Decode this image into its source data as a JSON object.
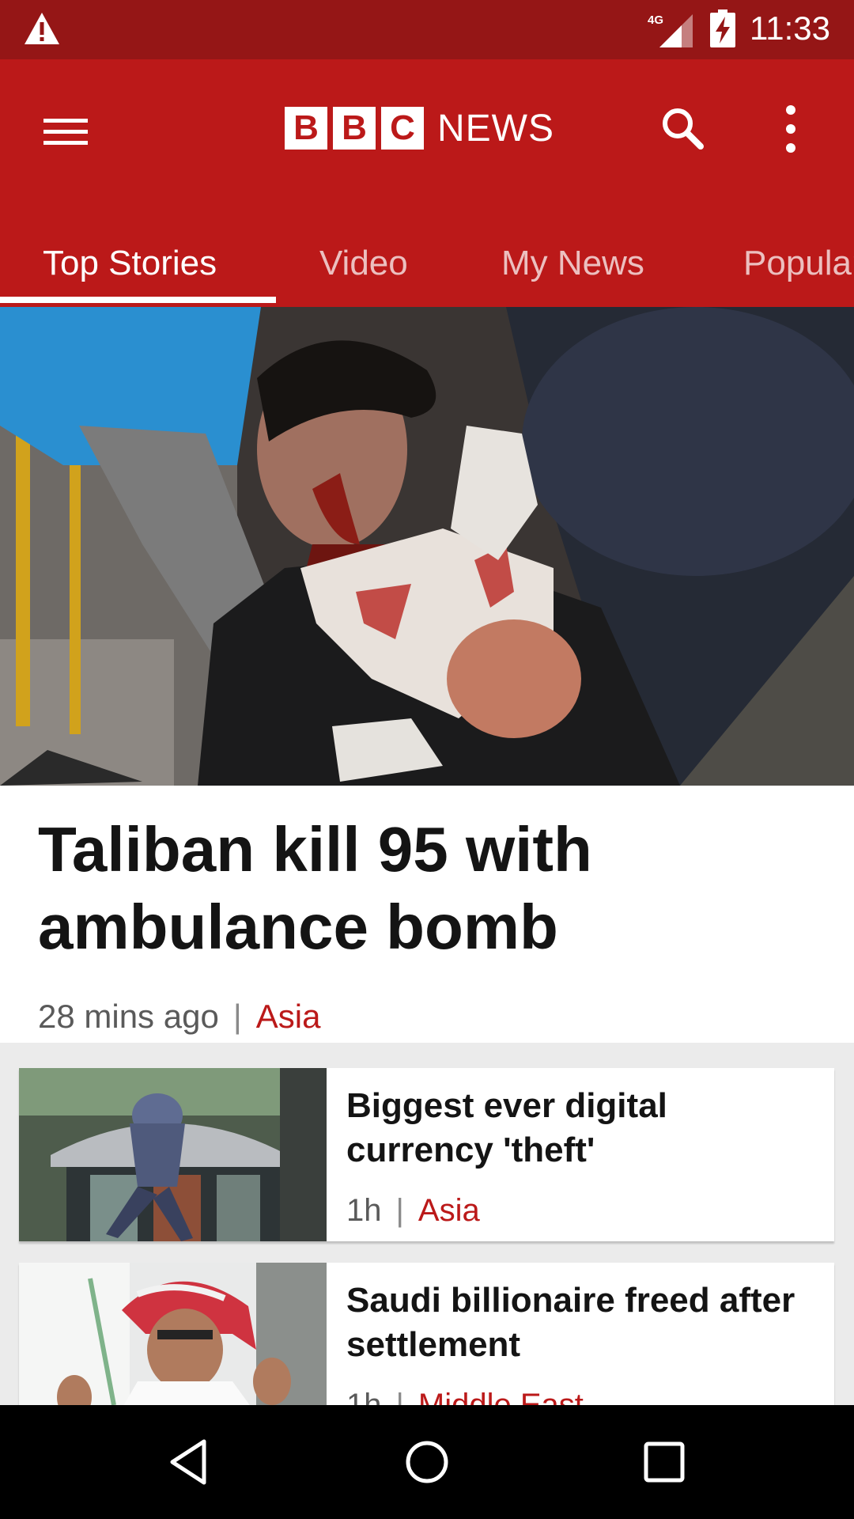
{
  "status_bar": {
    "time": "11:33",
    "network": "4G"
  },
  "app_bar": {
    "logo_letters": [
      "B",
      "B",
      "C"
    ],
    "logo_word": "NEWS",
    "icons": [
      "menu-icon",
      "search-icon",
      "more-vert-icon"
    ]
  },
  "tabs": [
    {
      "label": "Top Stories",
      "active": true
    },
    {
      "label": "Video"
    },
    {
      "label": "My News"
    },
    {
      "label": "Popular"
    }
  ],
  "hero": {
    "headline": "Taliban kill 95 with ambulance bomb",
    "time": "28 mins ago",
    "separator": "|",
    "section": "Asia"
  },
  "stories": [
    {
      "title": "Biggest ever digital currency 'theft'",
      "time": "1h",
      "separator": "|",
      "section": "Asia"
    },
    {
      "title": "Saudi billionaire freed after settlement",
      "time": "1h",
      "separator": "|",
      "section": "Middle East"
    }
  ],
  "colors": {
    "brand_red": "#bb1919",
    "status_red": "#951616",
    "nav_black": "#000000"
  },
  "nav_bar": {
    "icons": [
      "back-icon",
      "home-icon",
      "recents-icon"
    ]
  }
}
